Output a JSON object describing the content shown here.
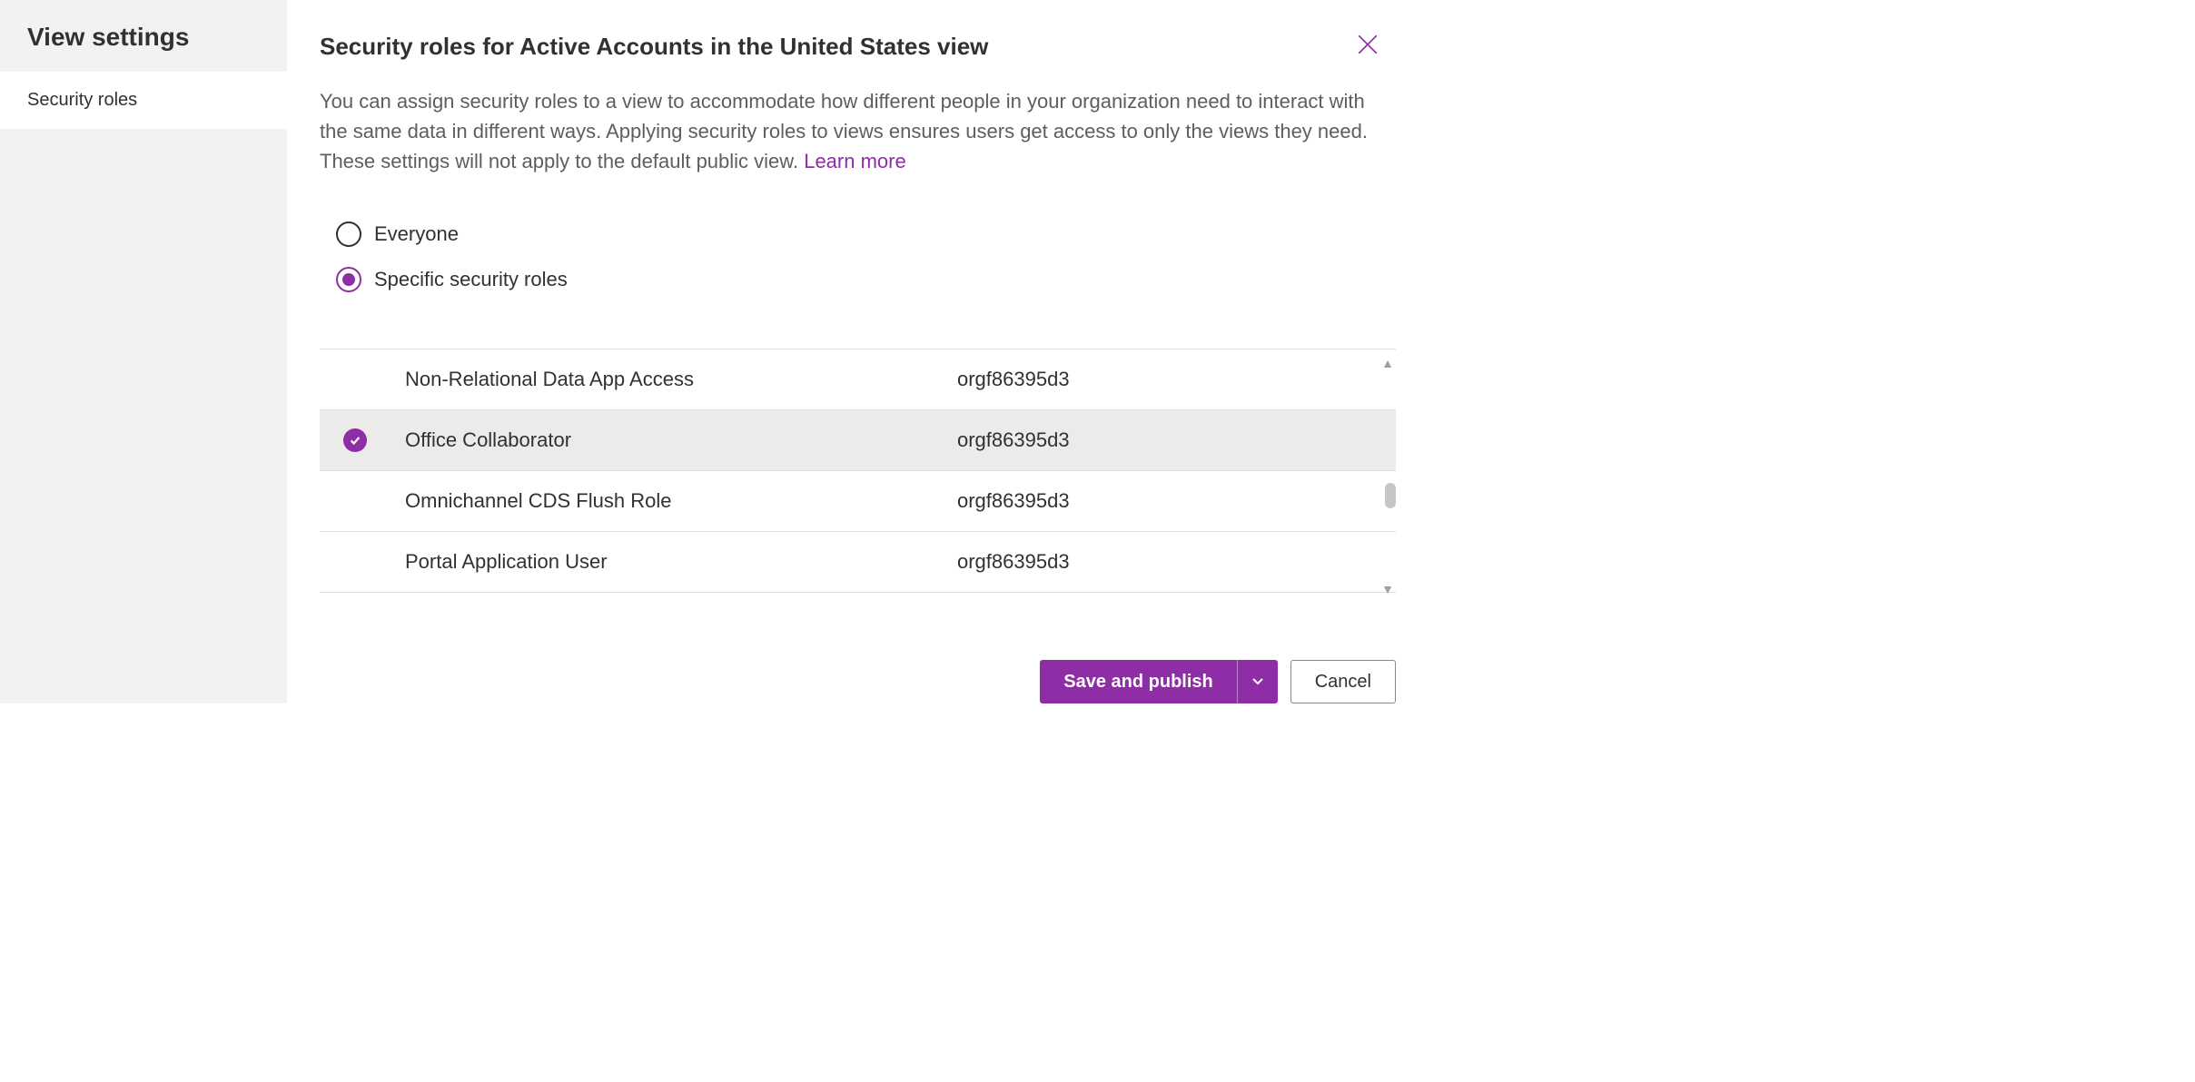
{
  "sidebar": {
    "title": "View settings",
    "items": [
      {
        "label": "Security roles",
        "active": true
      }
    ]
  },
  "header": {
    "title": "Security roles for Active Accounts in the United States view"
  },
  "description": {
    "text": "You can assign security roles to a view to accommodate how different people in your organization need to interact with the same data in different ways. Applying security roles to views ensures users get access to only the views they need. These settings will not apply to the default public view. ",
    "learn_more": "Learn more"
  },
  "radio": {
    "options": [
      {
        "label": "Everyone",
        "selected": false
      },
      {
        "label": "Specific security roles",
        "selected": true
      }
    ]
  },
  "roles": [
    {
      "name": "Non-Relational Data App Access",
      "org": "orgf86395d3",
      "selected": false
    },
    {
      "name": "Office Collaborator",
      "org": "orgf86395d3",
      "selected": true
    },
    {
      "name": "Omnichannel CDS Flush Role",
      "org": "orgf86395d3",
      "selected": false
    },
    {
      "name": "Portal Application User",
      "org": "orgf86395d3",
      "selected": false
    }
  ],
  "footer": {
    "primary": "Save and publish",
    "secondary": "Cancel"
  },
  "colors": {
    "accent": "#8e2da5"
  }
}
